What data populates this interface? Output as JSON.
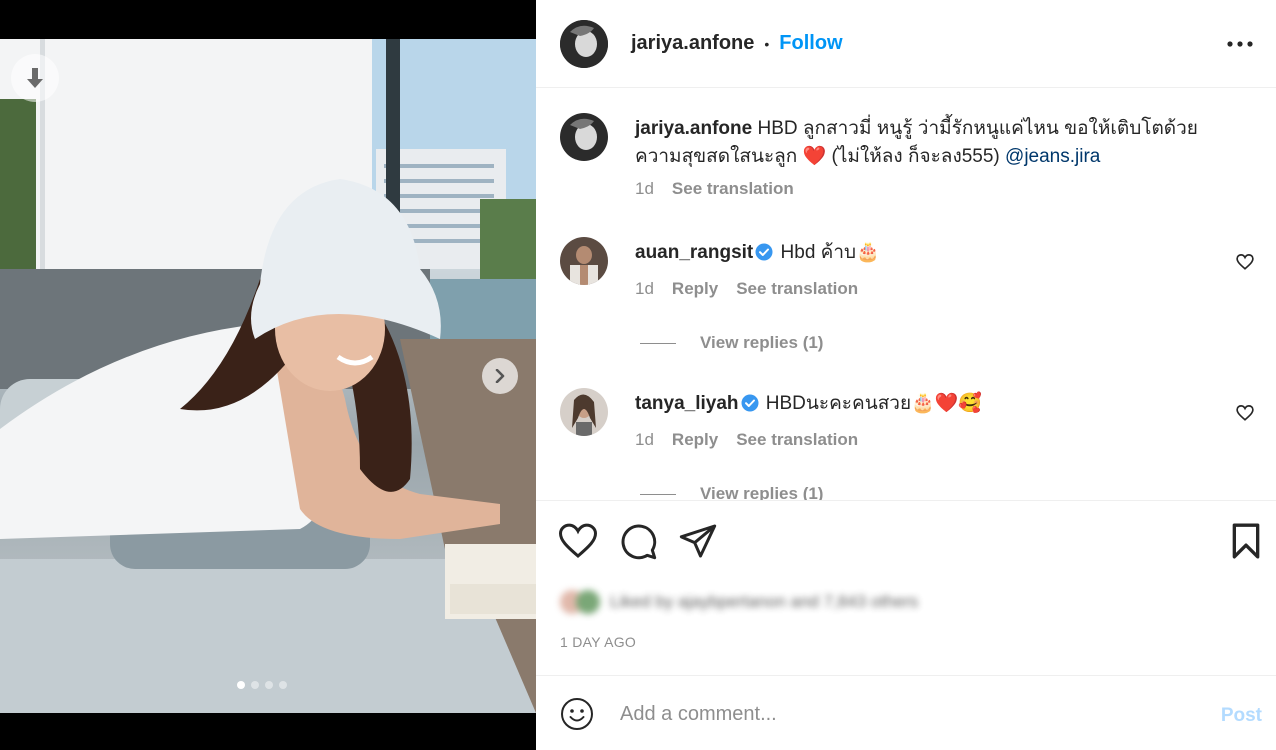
{
  "post": {
    "username": "jariya.anfone",
    "separator": "•",
    "follow_label": "Follow",
    "image_indicator": {
      "total": 4,
      "active": 1
    }
  },
  "caption": {
    "username": "jariya.anfone",
    "text_part1": "HBD ลูกสาวมี่ หนูรู้ ว่ามี้รักหนูแค่ไหน ขอให้เติบโตด้วยความสุขสดใสนะลูก",
    "emoji": "❤️",
    "text_part2": "(ไม่ให้ลง ก็จะลง555)",
    "mention": "@jeans.jira",
    "time": "1d",
    "see_translation": "See translation"
  },
  "comments": [
    {
      "username": "auan_rangsit",
      "text": "Hbd ค้าบ🎂",
      "time": "1d",
      "reply_label": "Reply",
      "see_translation": "See translation",
      "view_replies": "View replies (1)"
    },
    {
      "username": "tanya_liyah",
      "text": "HBDนะคะคนสวย🎂❤️🥰",
      "time": "1d",
      "reply_label": "Reply",
      "see_translation": "See translation",
      "view_replies": "View replies (1)"
    }
  ],
  "actions": {
    "like_icon": "heart-outline-icon",
    "comment_icon": "comment-bubble-icon",
    "share_icon": "paper-plane-icon",
    "save_icon": "bookmark-icon",
    "liked_by": "Liked by ajaybpertanon and 7,843 others",
    "timestamp": "1 DAY AGO"
  },
  "add_comment": {
    "placeholder": "Add a comment...",
    "post_label": "Post"
  },
  "colors": {
    "follow": "#0095f6",
    "mention": "#00376b",
    "muted": "#8e8e8e",
    "verified": "#3897f0",
    "post_disabled": "#b3dbff"
  }
}
